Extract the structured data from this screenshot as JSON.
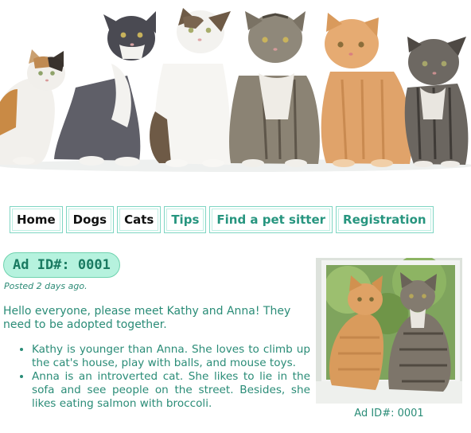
{
  "nav": {
    "items": [
      {
        "label": "Home",
        "style": "dark"
      },
      {
        "label": "Dogs",
        "style": "dark"
      },
      {
        "label": "Cats",
        "style": "dark"
      },
      {
        "label": "Tips",
        "style": "teal"
      },
      {
        "label": "Find a pet sitter",
        "style": "teal"
      },
      {
        "label": "Registration",
        "style": "teal"
      }
    ]
  },
  "ad": {
    "badge": "Ad ID#: 0001",
    "posted": "Posted 2 days ago.",
    "intro": "Hello everyone, please meet Kathy and Anna! They need to be adopted together.",
    "details": [
      "Kathy is younger than Anna. She loves to climb up the cat's house, play with balls, and mouse toys.",
      "Anna is an introverted cat. She likes to lie in the sofa and see people on the street. Besides, she likes eating salmon with broccoli."
    ],
    "caption": "Ad ID#: 0001"
  },
  "colors": {
    "accent": "#2a8c77",
    "badge_bg": "#b6f2de",
    "nav_border": "#7fd6c3"
  }
}
